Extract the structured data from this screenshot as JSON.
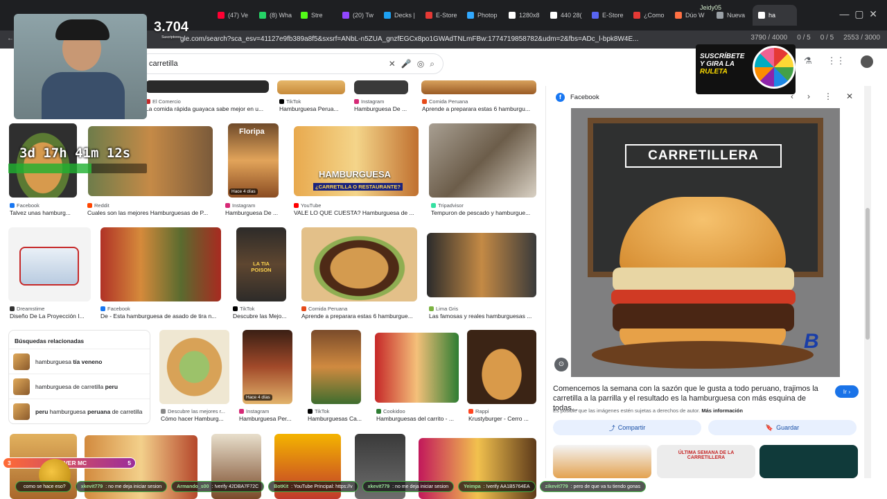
{
  "browser": {
    "tabs": [
      {
        "label": "(47) Ve",
        "color": "#ff0033"
      },
      {
        "label": "(8) Wha",
        "color": "#25d366"
      },
      {
        "label": "Stre",
        "color": "#53fc18"
      },
      {
        "label": "(20) Tw",
        "color": "#9146ff"
      },
      {
        "label": "Decks |",
        "color": "#1da1f2"
      },
      {
        "label": "E-Store",
        "color": "#e53935"
      },
      {
        "label": "Photop",
        "color": "#31a8ff"
      },
      {
        "label": "1280x8",
        "color": "#ffffff"
      },
      {
        "label": "440 28(",
        "color": "#ffffff"
      },
      {
        "label": "E-Store",
        "color": "#5865f2"
      },
      {
        "label": "¿Como",
        "color": "#e53935"
      },
      {
        "label": "Dúo W",
        "color": "#ff7043"
      },
      {
        "label": "Nueva",
        "color": "#9aa0a6"
      },
      {
        "label": "ha",
        "color": "#ffffff",
        "active": true
      }
    ],
    "profile_label": "Jeidy05",
    "url": "gle.com/search?sca_esv=41127e9fb389a8f5&sxsrf=ANbL-n5ZUA_gnzfEGCx8po1GWAdTNLmFBw:1774719858782&udm=2&fbs=ADc_l-bpk8W4E...",
    "ext_counters": [
      "3790 / 4000",
      "0 / 5",
      "0 / 5",
      "2553 / 3000"
    ]
  },
  "search": {
    "query": "carretilla"
  },
  "overlay": {
    "subs_count": "3.704",
    "subs_label": "Suscriptores",
    "timer": "3d 17h 41m 12s",
    "promo_line1": "SUSCRÍBETE",
    "promo_line2": "Y GIRA LA",
    "promo_line3": "RULETA",
    "server_label": "SERVER MC",
    "server_left": "3",
    "server_right": "5"
  },
  "results": {
    "row0": [
      {
        "source": "El Comercio",
        "caption": "La comida rápida guayaca sabe mejor en u..."
      },
      {
        "source": "TikTok",
        "caption": "Hamburguesa Perua..."
      },
      {
        "source": "Instagram",
        "caption": "Hamburguesa De ..."
      },
      {
        "source": "Comida Peruana",
        "caption": "Aprende a preparara estas 6 hamburgu..."
      }
    ],
    "row1": [
      {
        "source": "Facebook",
        "caption": "Talvez unas hamburg..."
      },
      {
        "source": "Reddit",
        "caption": "Cuales son las mejores Hamburguesas de P..."
      },
      {
        "source": "Instagram",
        "caption": "Hamburguesa De ...",
        "badge": "Hace 4 días",
        "overlay": "Floripa"
      },
      {
        "source": "YouTube",
        "caption": "VALE LO QUE CUESTA? Hamburguesa de ...",
        "overlay": "HAMBURGUESA",
        "overlay2": "¿CARRETILLA O RESTAURANTE?"
      },
      {
        "source": "Tripadvisor",
        "caption": "Tempuron de pescado y hamburgue..."
      }
    ],
    "row2": [
      {
        "source": "Dreamstime",
        "caption": "Diseño De La Proyección I..."
      },
      {
        "source": "Facebook",
        "caption": "De - Esta hamburguesa de asado de tira n..."
      },
      {
        "source": "TikTok",
        "caption": "Descubre las Mejo...",
        "overlay": "LA TIA POISON"
      },
      {
        "source": "Comida Peruana",
        "caption": "Aprende a preparara estas 6 hamburgue..."
      },
      {
        "source": "Lima Gris",
        "caption": "Las famosas y reales hamburguesas ..."
      }
    ],
    "related_title": "Búsquedas relacionadas",
    "related": [
      {
        "bold_pre": "",
        "text": "hamburguesa ",
        "bold": "tía veneno",
        "rest": ""
      },
      {
        "bold_pre": "",
        "text": "hamburguesa de carretilla ",
        "bold": "peru",
        "rest": ""
      },
      {
        "bold_pre": "peru",
        "text": " hamburguesa ",
        "bold": "peruana",
        "rest": " de carretilla"
      }
    ],
    "row3": [
      {
        "source": "Descubre las mejores r...",
        "caption": "Cómo hacer Hamburg..."
      },
      {
        "source": "Instagram",
        "caption": "Hamburguesa Per...",
        "badge": "Hace 4 días"
      },
      {
        "source": "TikTok",
        "caption": "Hamburguesas Ca..."
      },
      {
        "source": "Cookidoo",
        "caption": "Hamburguesas del carrito - ..."
      },
      {
        "source": "Rappi",
        "caption": "Krustyburger - Cerro ..."
      }
    ]
  },
  "panel": {
    "source": "Facebook",
    "sign_text": "CARRETILLERA",
    "description": "Comencemos la semana con la sazón que le gusta a todo peruano, trajimos la carretilla a la parrilla y el resultado es la hamburguesa con más esquina de todas...",
    "ir_label": "Ir",
    "copyright": "Es posible que las imágenes estén sujetas a derechos de autor.",
    "more_info": "Más información",
    "share_label": "Compartir",
    "save_label": "Guardar",
    "thumb_text": "ÚLTIMA SEMANA DE LA CARRETILLERA"
  },
  "chat": [
    {
      "user": "",
      "text": "como se hace eso?"
    },
    {
      "user": "xkevit779",
      "text": ": no me deja iniciar sesion"
    },
    {
      "user": "Armando_s00",
      "text": ": !verify 42DBA7F72C"
    },
    {
      "user": "BotKit",
      "text": ": YouTube Principal: https://v"
    },
    {
      "user": "xkevit779",
      "text": ": no me deja iniciar sesion"
    },
    {
      "user": "Yeimpa",
      "text": ": !verify AA1B5764EA"
    },
    {
      "user": "zikevit779",
      "text": ": pero de que va tu tiendo gonas"
    }
  ]
}
